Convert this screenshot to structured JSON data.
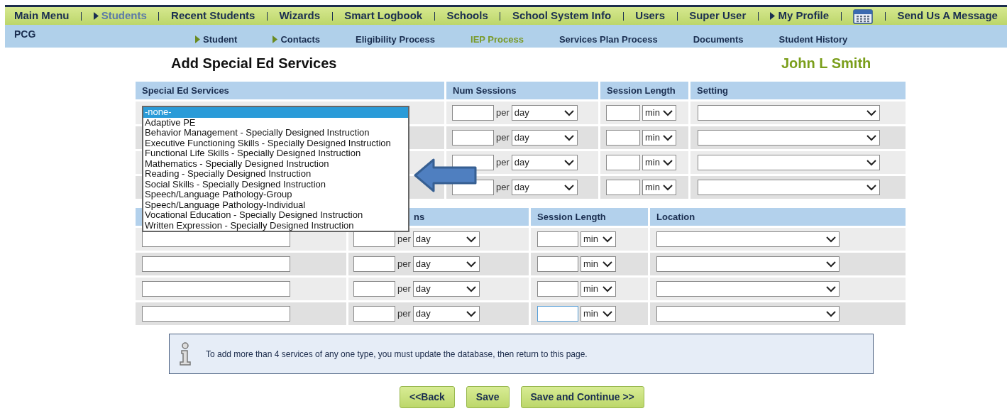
{
  "nav": {
    "items": [
      {
        "label": "Main Menu",
        "selected": false,
        "arrow": false,
        "kind": "text"
      },
      {
        "label": "Students",
        "selected": true,
        "arrow": true,
        "kind": "text"
      },
      {
        "label": "Recent Students",
        "selected": false,
        "arrow": false,
        "kind": "text"
      },
      {
        "label": "Wizards",
        "selected": false,
        "arrow": false,
        "kind": "text"
      },
      {
        "label": "Smart Logbook",
        "selected": false,
        "arrow": false,
        "kind": "text"
      },
      {
        "label": "Schools",
        "selected": false,
        "arrow": false,
        "kind": "text"
      },
      {
        "label": "School System Info",
        "selected": false,
        "arrow": false,
        "kind": "text"
      },
      {
        "label": "Users",
        "selected": false,
        "arrow": false,
        "kind": "text"
      },
      {
        "label": "Super User",
        "selected": false,
        "arrow": false,
        "kind": "text"
      },
      {
        "label": "My Profile",
        "selected": false,
        "arrow": true,
        "kind": "text"
      },
      {
        "kind": "calendar"
      },
      {
        "label": "Send Us A Message",
        "selected": false,
        "arrow": false,
        "kind": "text"
      }
    ]
  },
  "sub_nav": {
    "brand": "PCG",
    "items": [
      {
        "label": "Student",
        "selected": false,
        "arrow": true
      },
      {
        "label": "Contacts",
        "selected": false,
        "arrow": true
      },
      {
        "label": "Eligibility Process",
        "selected": false,
        "arrow": false
      },
      {
        "label": "IEP Process",
        "selected": true,
        "arrow": false
      },
      {
        "label": "Services Plan Process",
        "selected": false,
        "arrow": false
      },
      {
        "label": "Documents",
        "selected": false,
        "arrow": false
      },
      {
        "label": "Student History",
        "selected": false,
        "arrow": false
      }
    ]
  },
  "page": {
    "title": "Add Special Ed Services",
    "student_name": "John L Smith"
  },
  "services_table": {
    "columns": [
      "Special Ed Services",
      "Num Sessions",
      "Session Length",
      "Setting"
    ],
    "rows": [
      {
        "per_label": "per",
        "per_unit": "day",
        "length_unit": "min"
      },
      {
        "per_label": "per",
        "per_unit": "day",
        "length_unit": "min"
      },
      {
        "per_label": "per",
        "per_unit": "day",
        "length_unit": "min"
      },
      {
        "per_label": "per",
        "per_unit": "day",
        "length_unit": "min"
      }
    ],
    "service_list": {
      "expanded": true,
      "options": [
        {
          "label": "-none-",
          "selected": true
        },
        {
          "label": "Adaptive PE",
          "selected": false
        },
        {
          "label": "Behavior Management - Specially Designed Instruction",
          "selected": false
        },
        {
          "label": "Executive Functioning Skills - Specially Designed Instruction",
          "selected": false
        },
        {
          "label": "Functional Life Skills - Specially Designed Instruction",
          "selected": false
        },
        {
          "label": "Mathematics - Specially Designed Instruction",
          "selected": false
        },
        {
          "label": "Reading - Specially Designed Instruction",
          "selected": false
        },
        {
          "label": "Social Skills - Specially Designed Instruction",
          "selected": false
        },
        {
          "label": "Speech/Language Pathology-Group",
          "selected": false
        },
        {
          "label": "Speech/Language Pathology-Individual",
          "selected": false
        },
        {
          "label": "Vocational Education - Specially Designed Instruction",
          "selected": false
        },
        {
          "label": "Written Expression - Specially Designed Instruction",
          "selected": false
        }
      ]
    }
  },
  "second_table": {
    "columns": [
      "ns",
      "Session Length",
      "Location"
    ],
    "rows": [
      {
        "per_label": "per",
        "per_unit": "day",
        "length_unit": "min",
        "focused": false
      },
      {
        "per_label": "per",
        "per_unit": "day",
        "length_unit": "min",
        "focused": false
      },
      {
        "per_label": "per",
        "per_unit": "day",
        "length_unit": "min",
        "focused": false
      },
      {
        "per_label": "per",
        "per_unit": "day",
        "length_unit": "min",
        "focused": true
      }
    ]
  },
  "info": {
    "text": "To add more than 4 services of any one type, you must update the database, then return to this page."
  },
  "buttons": [
    "<<Back",
    "Save",
    "Save and Continue >>"
  ]
}
